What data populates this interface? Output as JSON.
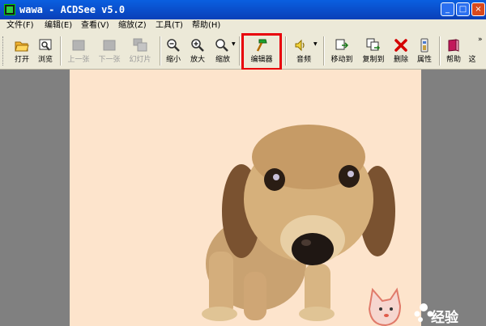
{
  "window": {
    "title": "wawa - ACDSee v5.0",
    "controls": {
      "minimize": "_",
      "maximize": "□",
      "close": "×"
    }
  },
  "menubar": {
    "items": [
      "文件(F)",
      "编辑(E)",
      "查看(V)",
      "缩放(Z)",
      "工具(T)",
      "帮助(H)"
    ]
  },
  "toolbar": {
    "buttons": [
      {
        "label": "打开",
        "icon": "open-folder-icon",
        "enabled": true
      },
      {
        "label": "浏览",
        "icon": "browse-icon",
        "enabled": true
      },
      {
        "label": "上一张",
        "icon": "previous-image-icon",
        "enabled": false
      },
      {
        "label": "下一张",
        "icon": "next-image-icon",
        "enabled": false
      },
      {
        "label": "幻灯片",
        "icon": "slideshow-icon",
        "enabled": false
      },
      {
        "label": "缩小",
        "icon": "zoom-out-icon",
        "enabled": true
      },
      {
        "label": "放大",
        "icon": "zoom-in-icon",
        "enabled": true
      },
      {
        "label": "缩放",
        "icon": "zoom-icon",
        "enabled": true
      },
      {
        "label": "编辑器",
        "icon": "editor-hammer-icon",
        "enabled": true
      },
      {
        "label": "音频",
        "icon": "audio-speaker-icon",
        "enabled": true
      },
      {
        "label": "移动到",
        "icon": "move-to-icon",
        "enabled": true
      },
      {
        "label": "复制到",
        "icon": "copy-to-icon",
        "enabled": true
      },
      {
        "label": "删除",
        "icon": "delete-x-icon",
        "enabled": true
      },
      {
        "label": "属性",
        "icon": "properties-icon",
        "enabled": true
      },
      {
        "label": "帮助",
        "icon": "help-book-icon",
        "enabled": true
      },
      {
        "label": "这",
        "icon": "",
        "enabled": true
      }
    ],
    "overflow": "»"
  },
  "colors": {
    "titlebar": "#0a4fd0",
    "menubar": "#ece9d8",
    "image_background": "#fde4cc",
    "highlight": "#e8000b"
  },
  "watermark": {
    "text": "经验"
  }
}
